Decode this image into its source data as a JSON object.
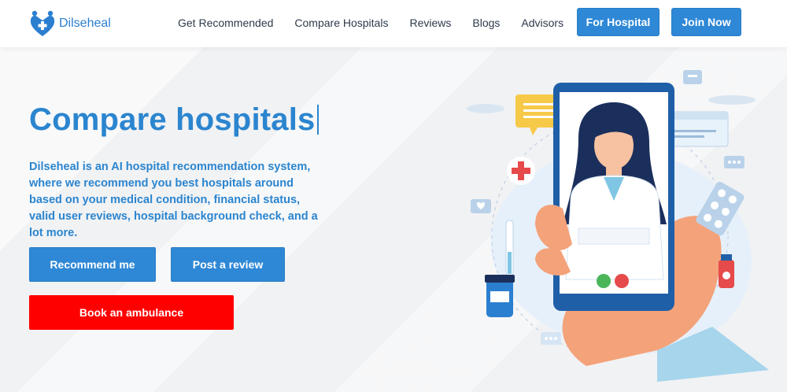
{
  "header": {
    "brand": "Dilseheal",
    "nav": [
      "Get Recommended",
      "Compare Hospitals",
      "Reviews",
      "Blogs",
      "Advisors"
    ],
    "for_hospital": "For Hospital",
    "join_now": "Join Now"
  },
  "hero": {
    "title": "Compare hospitals",
    "description": "Dilseheal is an AI hospital recommendation system, where we recommend you best hospitals around based on your medical condition, financial status, valid user reviews, hospital background check, and a lot more.",
    "recommend_label": "Recommend me",
    "review_label": "Post a review",
    "ambulance_label": "Book an ambulance"
  },
  "colors": {
    "primary": "#2e88d6",
    "title": "#2b85cf",
    "danger": "#ff0000"
  },
  "icons": [
    "logo-heart-icon",
    "doctor-phone-illustration"
  ]
}
